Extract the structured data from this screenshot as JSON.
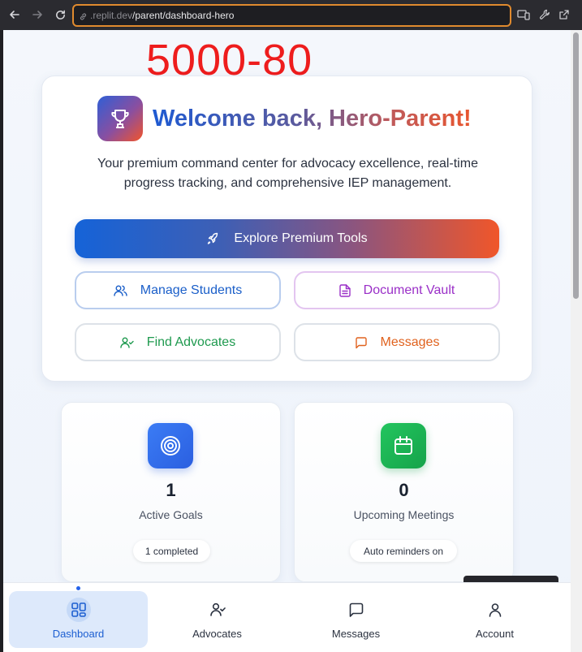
{
  "browser": {
    "url_domain": ".replit.dev",
    "url_path": "/parent/dashboard-hero",
    "colors": {
      "url_focus_border": "#e08a2e"
    }
  },
  "overlay": {
    "text": "5000-80",
    "color": "#ee1d1d"
  },
  "hero": {
    "title": "Welcome back, Hero-Parent!",
    "subtitle": "Your premium command center for advocacy excellence, real-time progress tracking, and comprehensive IEP management.",
    "icon": "trophy-icon",
    "primary_button": {
      "label": "Explore Premium Tools",
      "icon": "rocket-icon"
    },
    "actions": [
      {
        "label": "Manage Students",
        "icon": "users-icon",
        "color": "#1b5fc9"
      },
      {
        "label": "Document Vault",
        "icon": "file-text-icon",
        "color": "#9a2fc7"
      },
      {
        "label": "Find Advocates",
        "icon": "user-check-icon",
        "color": "#1f9a4f"
      },
      {
        "label": "Messages",
        "icon": "message-square-icon",
        "color": "#e0621e"
      }
    ]
  },
  "stats": [
    {
      "value": "1",
      "label": "Active Goals",
      "pill": "1 completed",
      "icon": "target-icon",
      "color": "#2b5fe0"
    },
    {
      "value": "0",
      "label": "Upcoming Meetings",
      "pill": "Auto reminders on",
      "icon": "calendar-icon",
      "color": "#16a34a"
    }
  ],
  "bottom_nav": {
    "active": "Dashboard",
    "items": [
      {
        "label": "Dashboard",
        "icon": "layout-grid-icon"
      },
      {
        "label": "Advocates",
        "icon": "user-check-icon"
      },
      {
        "label": "Messages",
        "icon": "message-square-icon"
      },
      {
        "label": "Account",
        "icon": "user-icon"
      }
    ],
    "colors": {
      "active": "#1d5fd1",
      "active_bg": "#dde9fb"
    }
  }
}
